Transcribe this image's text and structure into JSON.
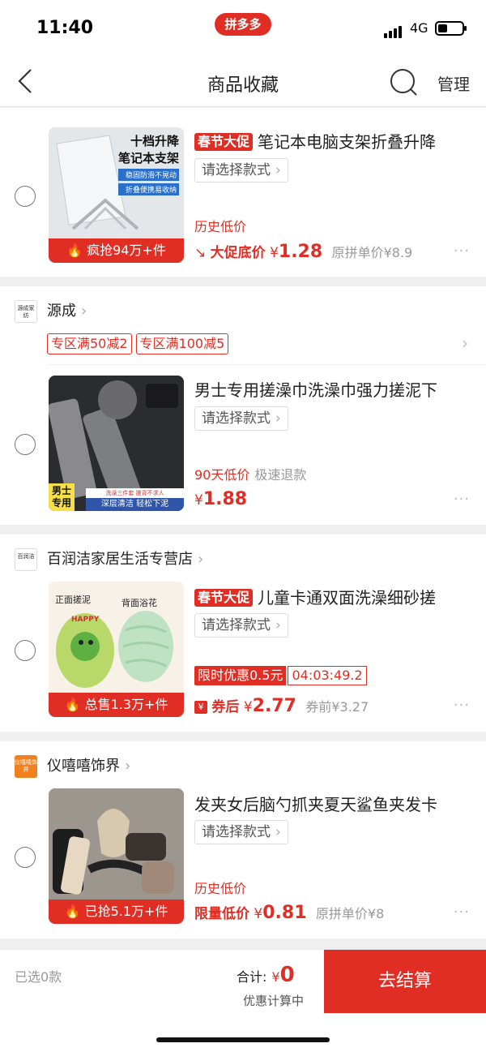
{
  "status_bar": {
    "time": "11:40",
    "brand": "拼多多",
    "network": "4G"
  },
  "header": {
    "title": "商品收藏",
    "manage": "管理"
  },
  "items": [
    {
      "promo_tag": "春节大促",
      "title": "笔记本电脑支架折叠升降",
      "select_label": "请选择款式",
      "note": "历史低价",
      "price_label": "大促底价",
      "price_currency": "¥",
      "price": "1.28",
      "orig_price": "原拼单价¥8.9",
      "thumb_strip": "疯抢94万+件",
      "thumb_text": [
        "十档升降",
        "笔记本支架",
        "稳固防滑不晃动",
        "折叠便携易收纳"
      ]
    },
    {
      "store_name": "源成",
      "store_logo": "源成家纺",
      "coupons": [
        "专区满50减2",
        "专区满100减5"
      ],
      "title": "男士专用搓澡巾洗澡巾强力搓泥下",
      "select_label": "请选择款式",
      "note": "90天低价",
      "note_gray": "极速退款",
      "price_currency": "¥",
      "price": "1.88",
      "thumb_text": [
        "男士",
        "专用",
        "深层清洁 轻松下泥",
        "洗澡三件套 搓背不求人"
      ]
    },
    {
      "store_name": "百润洁家居生活专营店",
      "store_logo": "百润洁",
      "promo_tag": "春节大促",
      "title": "儿童卡通双面洗澡细砂搓",
      "select_label": "请选择款式",
      "timer_label": "限时优惠0.5元",
      "timer_value": "04:03:49.2",
      "price_label": "券后",
      "price_currency": "¥",
      "price": "2.77",
      "orig_price": "券前¥3.27",
      "thumb_strip": "总售1.3万+件",
      "thumb_text": [
        "正面搓泥",
        "背面浴花",
        "HAPPY"
      ]
    },
    {
      "store_name": "仪嘻嘻饰界",
      "store_logo": "仪嘻嘻饰界",
      "title": "发夹女后脑勺抓夹夏天鲨鱼夹发卡",
      "select_label": "请选择款式",
      "note": "历史低价",
      "price_label": "限量低价",
      "price_currency": "¥",
      "price": "0.81",
      "orig_price": "原拼单价¥8",
      "thumb_strip": "已抢5.1万+件"
    }
  ],
  "more_label": "···",
  "bottom": {
    "selected": "已选0款",
    "total_label": "合计:",
    "total_currency": "¥",
    "total_value": "0",
    "calc_note": "优惠计算中",
    "checkout": "去结算"
  },
  "colors": {
    "accent": "#e02e24"
  }
}
